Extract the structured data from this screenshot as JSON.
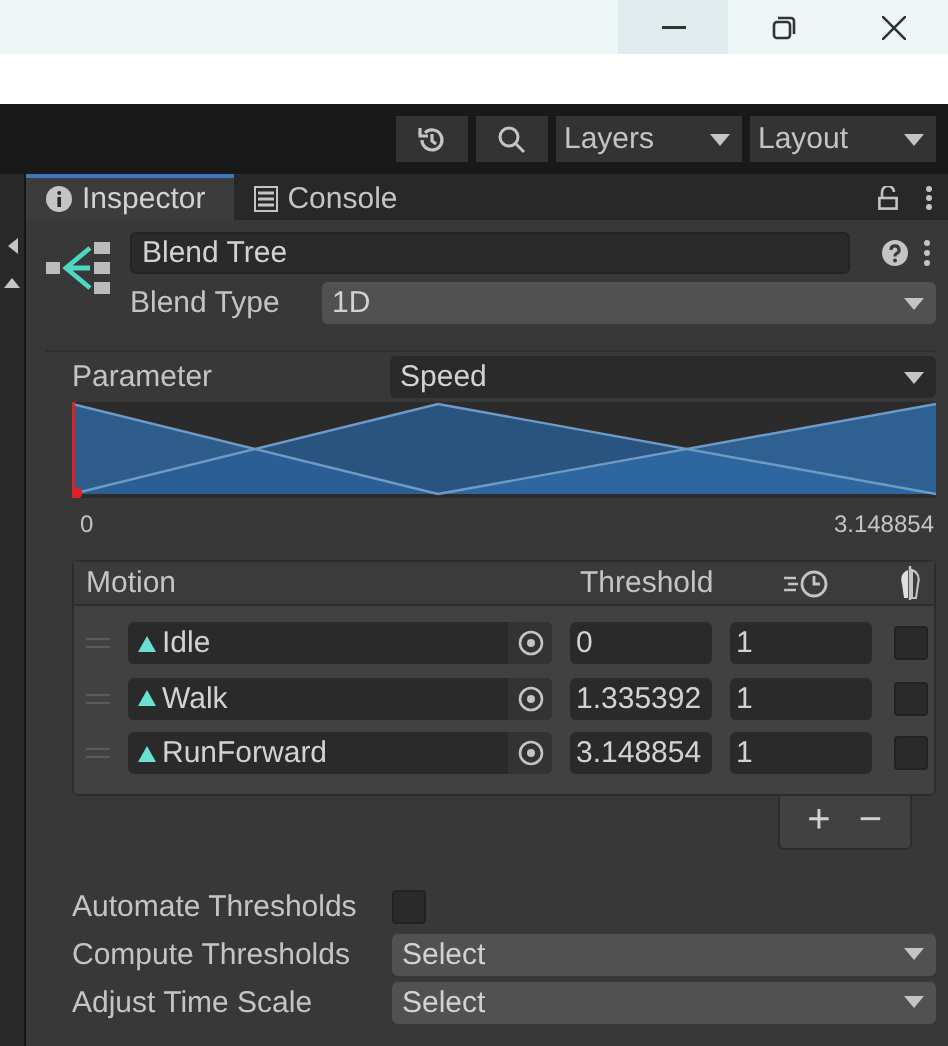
{
  "toolbar": {
    "layers": "Layers",
    "layout": "Layout"
  },
  "tabs": [
    {
      "label": "Inspector",
      "selected": true
    },
    {
      "label": "Console",
      "selected": false
    }
  ],
  "blend_tree": {
    "name": "Blend Tree",
    "blend_type_label": "Blend Type",
    "blend_type": "1D",
    "parameter_label": "Parameter",
    "parameter": "Speed",
    "range_min": "0",
    "range_max": "3.148854"
  },
  "motion_table": {
    "columns": [
      "Motion",
      "Threshold"
    ],
    "rows": [
      {
        "motion": "Idle",
        "threshold": "0",
        "time_scale": "1",
        "mirror": false
      },
      {
        "motion": "Walk",
        "threshold": "1.335392",
        "time_scale": "1",
        "mirror": false
      },
      {
        "motion": "RunForward",
        "threshold": "3.148854",
        "time_scale": "1",
        "mirror": false
      }
    ],
    "add": "+",
    "remove": "−"
  },
  "settings": [
    {
      "kind": "checkbox",
      "label": "Automate Thresholds",
      "checked": false
    },
    {
      "kind": "select",
      "label": "Compute Thresholds",
      "value": "Select"
    },
    {
      "kind": "select",
      "label": "Adjust Time Scale",
      "value": "Select"
    }
  ]
}
